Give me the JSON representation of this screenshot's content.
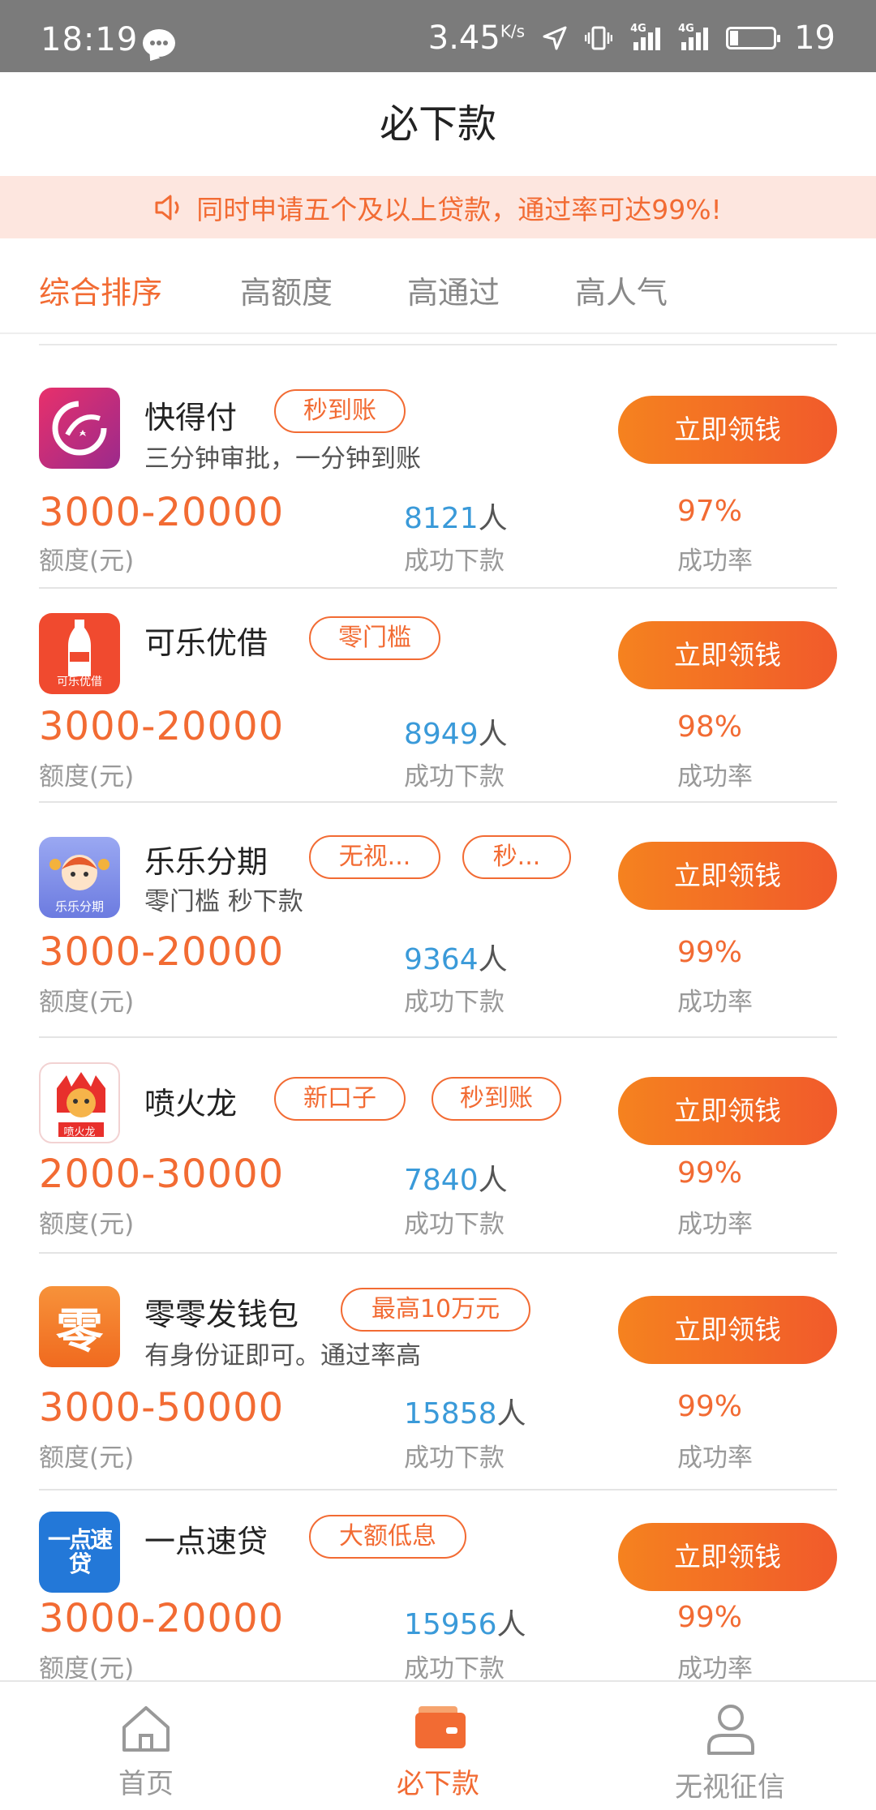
{
  "status_bar": {
    "time": "18:19",
    "speed": "3.45",
    "speed_unit": "K/s",
    "network_1": "4G",
    "network_2": "4G",
    "battery": "19"
  },
  "header": {
    "title": "必下款"
  },
  "notice": {
    "text": "同时申请五个及以上贷款，通过率可达99%!"
  },
  "tabs": [
    {
      "label": "综合排序",
      "active": true
    },
    {
      "label": "高额度",
      "active": false
    },
    {
      "label": "高通过",
      "active": false
    },
    {
      "label": "高人气",
      "active": false
    }
  ],
  "common": {
    "button_label": "立即领钱",
    "amount_label": "额度(元)",
    "count_label": "成功下款",
    "count_unit": "人",
    "rate_label": "成功率"
  },
  "products": [
    {
      "name": "快得付",
      "tags": [
        "秒到账"
      ],
      "desc": "三分钟审批，一分钟到账",
      "amount": "3000-20000",
      "count": "8121",
      "rate": "97%",
      "logo_text": ""
    },
    {
      "name": "可乐优借",
      "tags": [
        "零门槛"
      ],
      "desc": "",
      "amount": "3000-20000",
      "count": "8949",
      "rate": "98%",
      "logo_text": "可乐优借"
    },
    {
      "name": "乐乐分期",
      "tags": [
        "无视...",
        "秒..."
      ],
      "desc": "零门槛 秒下款",
      "amount": "3000-20000",
      "count": "9364",
      "rate": "99%",
      "logo_text": "乐乐分期"
    },
    {
      "name": "喷火龙",
      "tags": [
        "新口子",
        "秒到账"
      ],
      "desc": "",
      "amount": "2000-30000",
      "count": "7840",
      "rate": "99%",
      "logo_text": "喷火龙"
    },
    {
      "name": "零零发钱包",
      "tags": [
        "最高10万元"
      ],
      "desc": "有身份证即可。通过率高",
      "amount": "3000-50000",
      "count": "15858",
      "rate": "99%",
      "logo_text": "零"
    },
    {
      "name": "一点速贷",
      "tags": [
        "大额低息"
      ],
      "desc": "",
      "amount": "3000-20000",
      "count": "15956",
      "rate": "99%",
      "logo_text": "一点速贷"
    }
  ],
  "bottom_nav": [
    {
      "label": "首页",
      "icon": "home-icon",
      "active": false
    },
    {
      "label": "必下款",
      "icon": "wallet-icon",
      "active": true
    },
    {
      "label": "无视征信",
      "icon": "user-icon",
      "active": false
    }
  ],
  "colors": {
    "accent": "#f26b33",
    "count_blue": "#3a9ad9",
    "notice_bg": "#fde6df"
  }
}
